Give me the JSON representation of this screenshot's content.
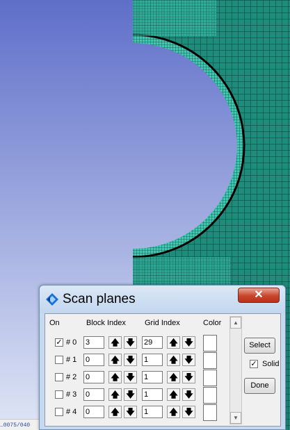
{
  "dialog": {
    "title": "Scan planes",
    "close_label": "✕",
    "headers": {
      "on": "On",
      "block_index": "Block Index",
      "grid_index": "Grid Index",
      "color": "Color"
    },
    "rows": [
      {
        "label": "# 0",
        "checked": "✓",
        "block": "3",
        "grid": "29"
      },
      {
        "label": "# 1",
        "checked": "",
        "block": "0",
        "grid": "1"
      },
      {
        "label": "# 2",
        "checked": "",
        "block": "0",
        "grid": "1"
      },
      {
        "label": "# 3",
        "checked": "",
        "block": "0",
        "grid": "1"
      },
      {
        "label": "# 4",
        "checked": "",
        "block": "0",
        "grid": "1"
      }
    ],
    "arrow_up": "🡅",
    "arrow_down": "🡇",
    "select_label": "Select",
    "solid_label": "Solid",
    "solid_checked": "✓",
    "done_label": "Done",
    "scroll_up": "▲",
    "scroll_down": "▼"
  },
  "status": {
    "text": "…0075/040"
  },
  "colors": {
    "sky_top": "#5f6fc9",
    "sky_bottom": "#dfe6f6",
    "mesh": "#1e8f7d",
    "mesh_light": "#4ed8c2"
  },
  "icons": {
    "app": "diamond-logo-icon"
  }
}
